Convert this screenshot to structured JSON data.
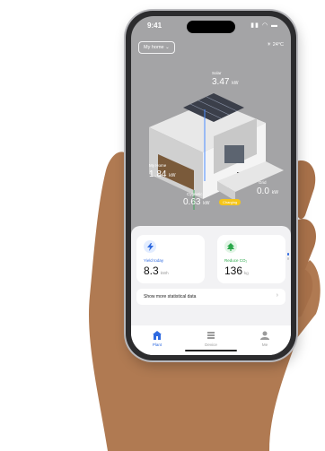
{
  "status_bar": {
    "time": "9:41"
  },
  "header": {
    "home_selector": "My home",
    "weather": "24°C"
  },
  "energy": {
    "solar": {
      "label": "Solar",
      "value": "3.47",
      "unit": "kW"
    },
    "home": {
      "label": "My Home",
      "value": "1.84",
      "unit": "kW"
    },
    "grid": {
      "label": "Grid",
      "value": "0.0",
      "unit": "kW"
    },
    "storage": {
      "label": "Cygnetic",
      "value": "0.63",
      "unit": "kW",
      "badge": "Charging"
    }
  },
  "stats": {
    "yield": {
      "label": "Yield today",
      "value": "8.3",
      "unit": "kWh"
    },
    "co2": {
      "label": "Reduce CO₂",
      "value": "136",
      "unit": "kg"
    }
  },
  "more_link": {
    "label": "Show more statistical data"
  },
  "tabs": [
    {
      "label": "Plant"
    },
    {
      "label": "Device"
    },
    {
      "label": "Me"
    }
  ],
  "colors": {
    "accent": "#2f6ae0",
    "green": "#2aa84a",
    "yellow": "#f5c518"
  }
}
